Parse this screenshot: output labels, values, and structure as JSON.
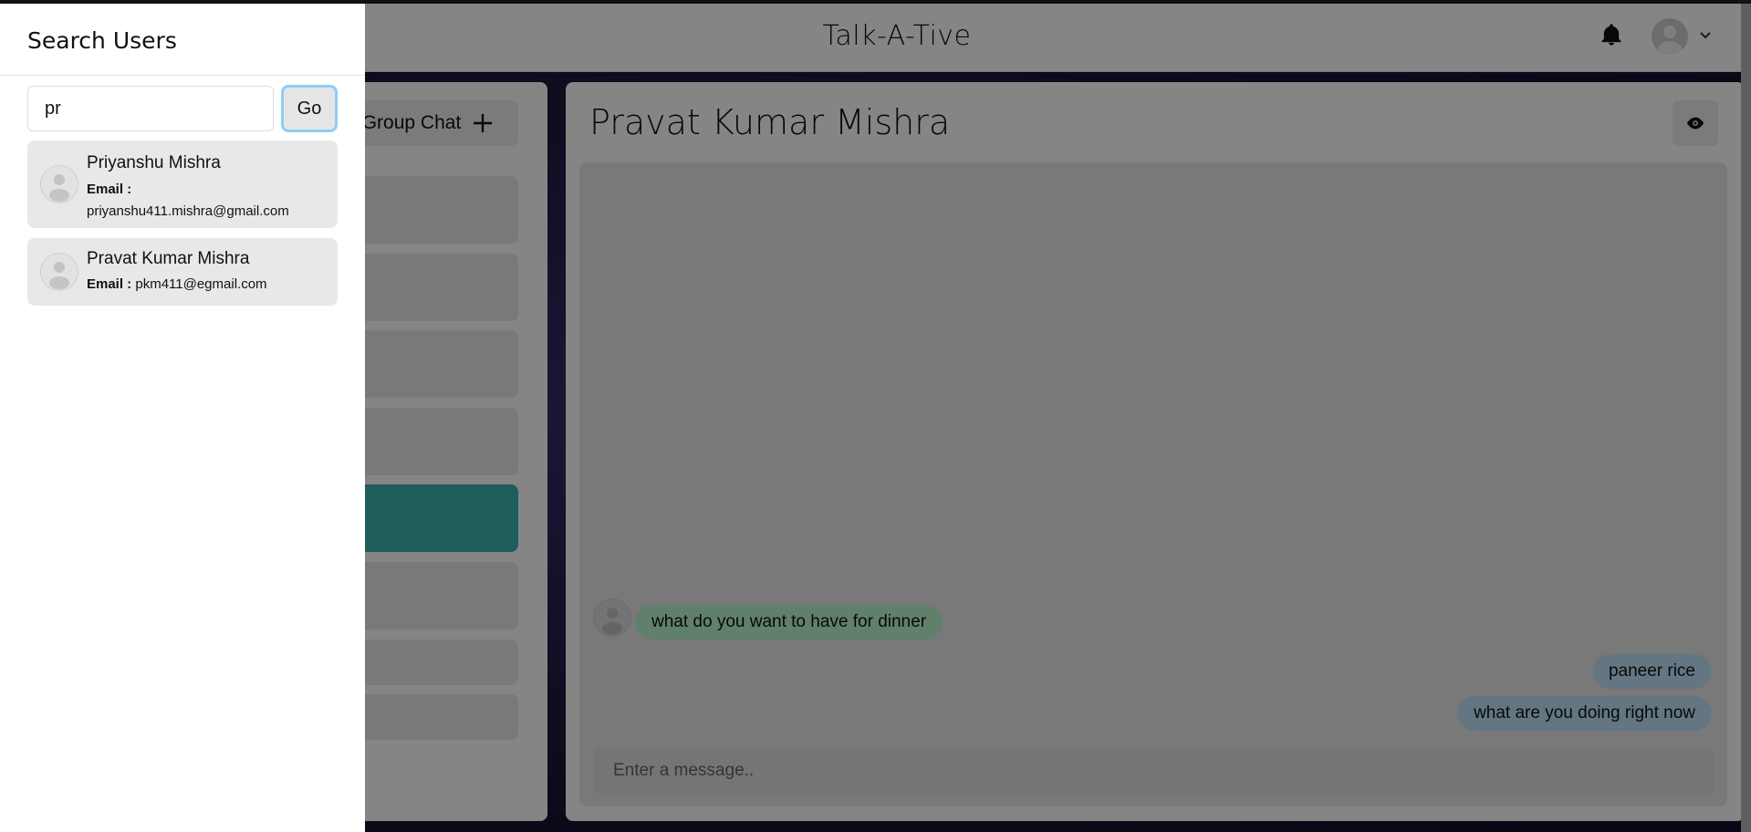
{
  "app": {
    "title": "Talk-A-Tive"
  },
  "header": {
    "bell_icon": "bell-icon",
    "avatar_icon": "user-avatar-icon",
    "menu_icon": "chevron-down-icon"
  },
  "sidebar": {
    "new_group_label": "Group Chat",
    "new_group_icon": "plus-icon"
  },
  "chat": {
    "title": "Pravat Kumar Mishra",
    "view_profile_icon": "eye-icon",
    "messages": [
      {
        "text": "what do you want to have for dinner",
        "direction": "received"
      },
      {
        "text": "paneer rice",
        "direction": "sent"
      },
      {
        "text": "what are you doing right now",
        "direction": "sent"
      }
    ],
    "input_placeholder": "Enter a message.."
  },
  "drawer": {
    "title": "Search Users",
    "search_value": "pr",
    "go_label": "Go",
    "results": [
      {
        "name": "Priyanshu Mishra",
        "email_label": "Email :",
        "email": "priyanshu411.mishra@gmail.com"
      },
      {
        "name": "Pravat Kumar Mishra",
        "email_label": "Email :",
        "email": "pkm411@egmail.com"
      }
    ]
  },
  "colors": {
    "accent": "#38b2ac",
    "received_bubble": "#b9f5d0",
    "sent_bubble": "#bee3f8",
    "focus_ring": "#90cdf4"
  }
}
